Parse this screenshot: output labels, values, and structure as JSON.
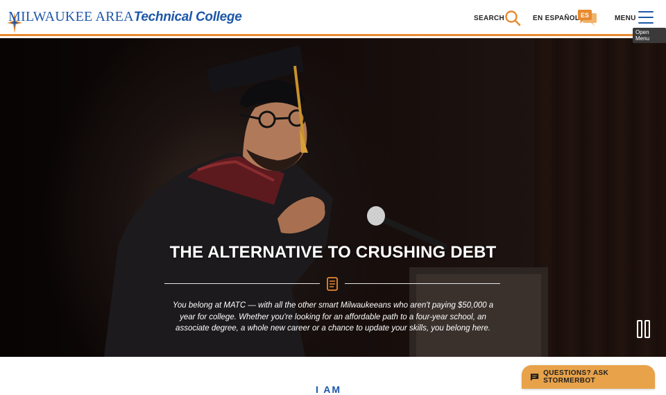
{
  "header": {
    "logo": {
      "line_first": "MILWAUKEE AREA",
      "line_bold": "Technical College"
    },
    "nav": {
      "search_label": "SEARCH",
      "espanol_label": "EN ESPAÑOL",
      "espanol_badge": "ES",
      "menu_label": "MENU",
      "menu_tooltip": "Open Menu"
    }
  },
  "hero": {
    "title": "THE ALTERNATIVE TO CRUSHING DEBT",
    "text": "You belong at MATC — with all the other smart Milwaukeeans who aren't paying $50,000 a year for college. Whether you're looking for an affordable path to a four-year school, an associate degree, a whole new career or a chance to update your skills, you belong here.",
    "pause_icon": "pause-icon"
  },
  "below": {
    "heading_partial": "I AM"
  },
  "chat": {
    "label": "QUESTIONS? ASK STORMERBOT",
    "icon": "chat-bubble-icon"
  },
  "colors": {
    "brand_blue": "#1d57a8",
    "accent_orange": "#e8892f",
    "chat_orange": "#e8a24a"
  }
}
